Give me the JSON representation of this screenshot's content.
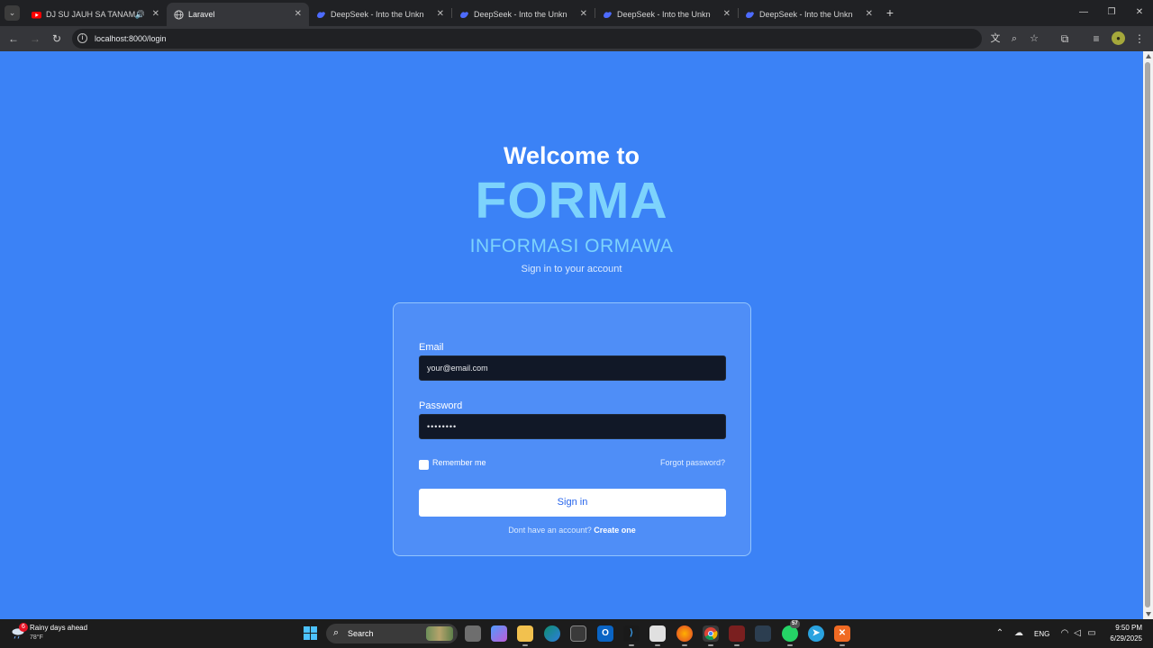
{
  "browser": {
    "tabs": [
      {
        "title": "DJ SU JAUH SA TANAM HATI",
        "favicon": "youtube-icon",
        "active": false,
        "audio": true
      },
      {
        "title": "Laravel",
        "favicon": "globe-icon",
        "active": true,
        "audio": false
      },
      {
        "title": "DeepSeek - Into the Unknown",
        "favicon": "deepseek-icon",
        "active": false,
        "audio": false
      },
      {
        "title": "DeepSeek - Into the Unknown",
        "favicon": "deepseek-icon",
        "active": false,
        "audio": false
      },
      {
        "title": "DeepSeek - Into the Unknown",
        "favicon": "deepseek-icon",
        "active": false,
        "audio": false
      },
      {
        "title": "DeepSeek - Into the Unknown",
        "favicon": "deepseek-icon",
        "active": false,
        "audio": false
      }
    ],
    "address_bar": {
      "url": "localhost:8000/login"
    }
  },
  "page": {
    "welcome": "Welcome to",
    "brand": "FORMA",
    "subtitle": "INFORMASI ORMAWA",
    "signin_hint": "Sign in to your account",
    "form": {
      "email_label": "Email",
      "email_value": "your@email.com",
      "password_label": "Password",
      "password_value": "••••••••",
      "remember_label": "Remember me",
      "remember_checked": false,
      "forgot_link": "Forgot password?",
      "submit_label": "Sign in",
      "register_prompt": "Dont have an account?",
      "register_link": "Create one"
    }
  },
  "taskbar": {
    "weather": {
      "title": "Rainy days ahead",
      "temp": "78°F",
      "badge": "6"
    },
    "search_label": "Search",
    "tray": {
      "language": "ENG",
      "whatsapp_badge": "57"
    },
    "clock": {
      "time": "9:50 PM",
      "date": "6/29/2025"
    }
  },
  "colors": {
    "page_background": "#3b82f6",
    "brand": "#7dd3fc",
    "card": "#4f8ef7",
    "input_background": "#111827",
    "button_text": "#2563eb"
  }
}
